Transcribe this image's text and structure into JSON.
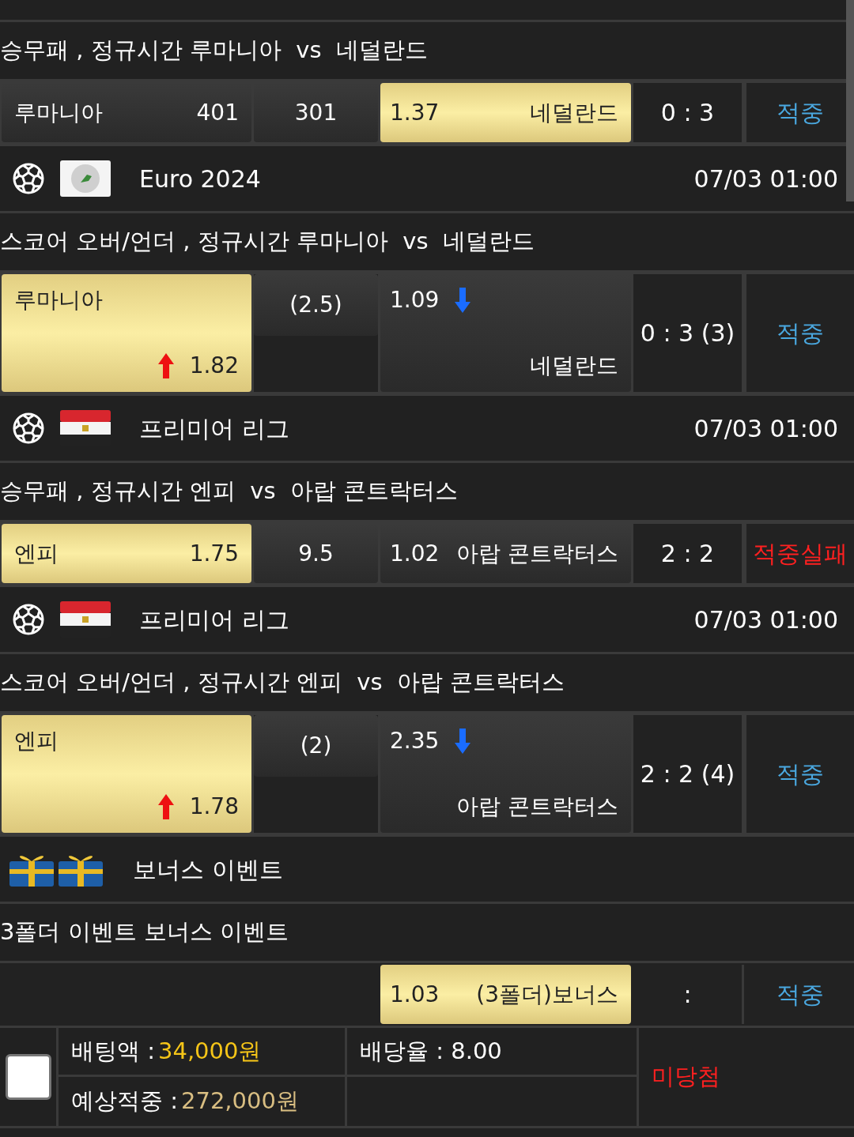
{
  "sections": [
    {
      "market": "승무패 , 정규시간 루마니아  vs  네덜란드",
      "bet": {
        "kind": "moneyline",
        "home": {
          "name": "루마니아",
          "odds": "401",
          "selected": false
        },
        "draw": {
          "value": "301",
          "selected": false
        },
        "away": {
          "name": "네덜란드",
          "odds": "1.37",
          "selected": true
        },
        "score": "0 : 3",
        "result": {
          "text": "적중",
          "kind": "hit"
        }
      }
    },
    {
      "league": {
        "icons": [
          {
            "kind": "soccer"
          },
          {
            "kind": "globe"
          }
        ],
        "name": "Euro 2024",
        "time": "07/03 01:00"
      },
      "market": "스코어 오버/언더 , 정규시간 루마니아  vs  네덜란드",
      "bet": {
        "kind": "overunder",
        "home": {
          "name": "루마니아",
          "odds": "1.82",
          "arrow": {
            "kind": "up"
          },
          "selected": true
        },
        "draw": {
          "value": "(2.5)",
          "selected": false
        },
        "away": {
          "name": "네덜란드",
          "odds": "1.09",
          "arrow": {
            "kind": "down"
          },
          "selected": false
        },
        "score": "0 : 3 (3)",
        "result": {
          "text": "적중",
          "kind": "hit"
        }
      }
    },
    {
      "league": {
        "icons": [
          {
            "kind": "soccer"
          },
          {
            "kind": "egypt"
          }
        ],
        "name": "프리미어 리그",
        "time": "07/03 01:00"
      },
      "market": "승무패 , 정규시간 엔피  vs  아랍 콘트락터스",
      "bet": {
        "kind": "moneyline",
        "home": {
          "name": "엔피",
          "odds": "1.75",
          "selected": true
        },
        "draw": {
          "value": "9.5",
          "selected": false
        },
        "away": {
          "name": "아랍 콘트락터스",
          "odds": "1.02",
          "selected": false
        },
        "score": "2 : 2",
        "result": {
          "text": "적중실패",
          "kind": "miss"
        }
      }
    },
    {
      "league": {
        "icons": [
          {
            "kind": "soccer"
          },
          {
            "kind": "egypt"
          }
        ],
        "name": "프리미어 리그",
        "time": "07/03 01:00"
      },
      "market": "스코어 오버/언더 , 정규시간 엔피  vs  아랍 콘트락터스",
      "bet": {
        "kind": "overunder",
        "home": {
          "name": "엔피",
          "odds": "1.78",
          "arrow": {
            "kind": "up"
          },
          "selected": true
        },
        "draw": {
          "value": "(2)",
          "selected": false
        },
        "away": {
          "name": "아랍 콘트락터스",
          "odds": "2.35",
          "arrow": {
            "kind": "down"
          },
          "selected": false
        },
        "score": "2 : 2 (4)",
        "result": {
          "text": "적중",
          "kind": "hit"
        }
      }
    },
    {
      "league": {
        "icons": [
          {
            "kind": "gift"
          }
        ],
        "name": "보너스 이벤트"
      },
      "market": "3폴더 이벤트 보너스 이벤트",
      "bet": {
        "kind": "single",
        "away": {
          "name": "(3폴더)보너스",
          "odds": "1.03",
          "selected": true
        },
        "score": ":",
        "result": {
          "text": "적중",
          "kind": "hit"
        }
      }
    }
  ],
  "summary": {
    "checked": false,
    "amount_label": "배팅액 :",
    "amount": "34,000원",
    "rate": "배당율 : 8.00",
    "expected_label": "예상적중 :",
    "expected": "272,000원",
    "status": "미당첨"
  }
}
